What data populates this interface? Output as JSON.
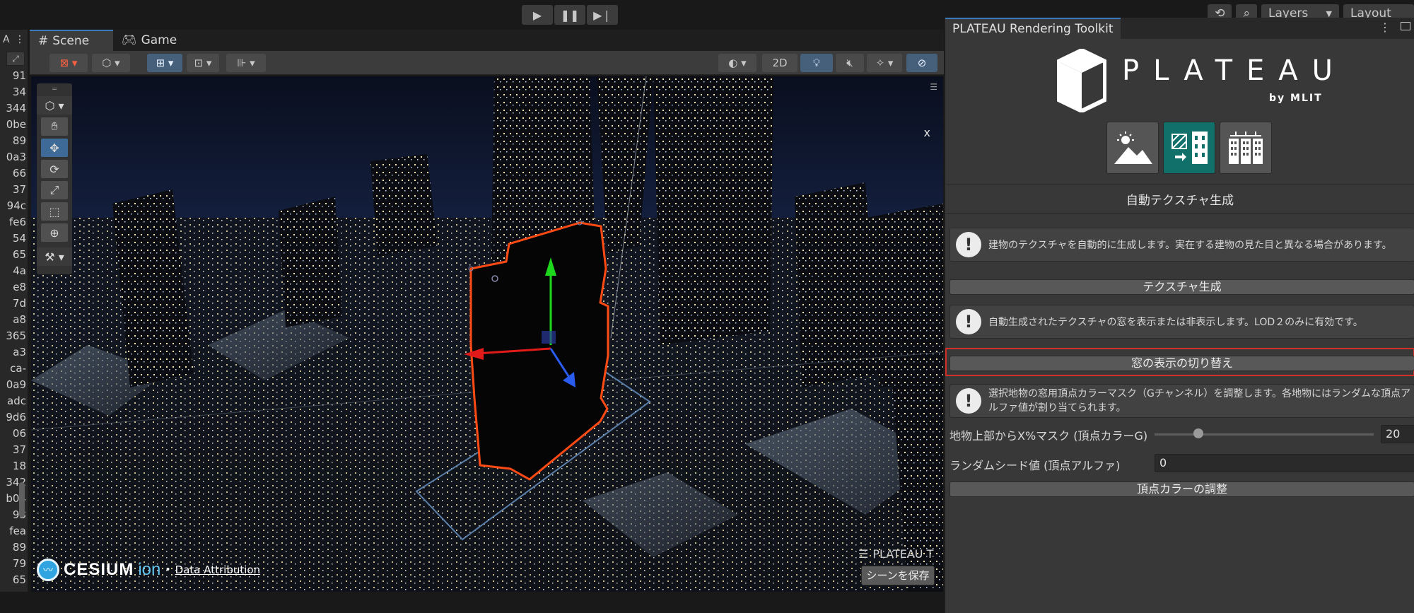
{
  "toolbar": {
    "play_icon": "play-icon",
    "pause_icon": "pause-icon",
    "step_icon": "step-icon",
    "history_icon": "history-icon",
    "search_icon": "search-icon",
    "layers_label": "Layers",
    "layout_label": "Layout"
  },
  "hierarchy": {
    "lines": [
      "91",
      "34",
      "344",
      "0be",
      "89",
      "0a3",
      "66",
      "37",
      "94c",
      "fe6",
      "54",
      "65",
      "4a",
      "e8",
      "7d",
      "a8",
      "365",
      "a3",
      "ca-",
      "0a9",
      "adc",
      "9d6",
      "06",
      "37",
      "18",
      "342",
      "b04",
      "93",
      "fea",
      "89",
      "79",
      "65"
    ]
  },
  "scene": {
    "tabs": [
      {
        "label": "Scene",
        "icon": "grid-icon"
      },
      {
        "label": "Game",
        "icon": "gamepad-icon"
      }
    ],
    "toolbar_2d_label": "2D",
    "axis_label": "x",
    "overlay_title": "PLATEAU T",
    "save_scene_label": "シーンを保存",
    "cesium_brand": "CESIUM",
    "cesium_ion": "ion",
    "data_attribution": "Data Attribution"
  },
  "inspector": {
    "tab_title": "PLATEAU Rendering Toolkit",
    "logo_text": "PLATEAU",
    "logo_sub": "by MLIT",
    "section_title": "自動テクスチャ生成",
    "help1": "建物のテクスチャを自動的に生成します。実在する建物の見た目と異なる場合があります。",
    "btn_generate": "テクスチャ生成",
    "help2": "自動生成されたテクスチャの窓を表示または非表示します。LOD２のみに有効です。",
    "btn_toggle_windows": "窓の表示の切り替え",
    "help3": "選択地物の窓用頂点カラーマスク（Gチャンネル）を調整します。各地物にはランダムな頂点アルファ値が割り当てられます。",
    "slider_label": "地物上部からX%マスク (頂点カラーG)",
    "slider_value": "20",
    "slider_fraction": 0.2,
    "seed_label": "ランダムシード値 (頂点アルファ)",
    "seed_value": "0",
    "btn_adjust": "頂点カラーの調整",
    "highlight_color": "#d0302a",
    "accent_teal": "#11706a"
  }
}
